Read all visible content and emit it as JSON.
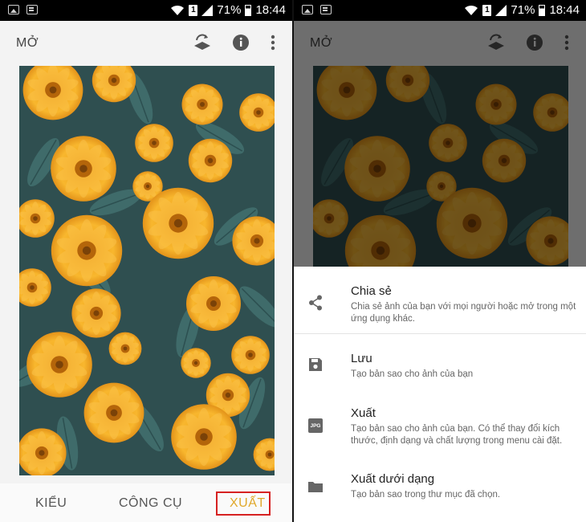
{
  "status_bar": {
    "battery": "71%",
    "time": "18:44",
    "sim_slot": "1"
  },
  "app_bar": {
    "title": "MỞ"
  },
  "bottom_tabs": [
    {
      "label": "KIỂU"
    },
    {
      "label": "CÔNG CỤ"
    },
    {
      "label": "XUẤT",
      "active": true
    }
  ],
  "accent_color": "#e0a82a",
  "highlight_color": "#d62121",
  "export_menu": {
    "items": [
      {
        "icon": "share-icon",
        "title": "Chia sẻ",
        "description": "Chia sẻ ảnh của bạn với mọi người hoặc mở trong một ứng dụng khác."
      },
      {
        "icon": "save-icon",
        "title": "Lưu",
        "description": "Tạo bản sao cho ảnh của bạn"
      },
      {
        "icon": "jpg-icon",
        "icon_label": "JPG",
        "title": "Xuất",
        "description": "Tạo bản sao cho ảnh của bạn. Có thể thay đổi kích thước, định dạng và chất lượng trong menu cài đặt."
      },
      {
        "icon": "folder-icon",
        "title": "Xuất dưới dạng",
        "description": "Tạo bản sao trong thư mục đã chọn."
      }
    ]
  }
}
